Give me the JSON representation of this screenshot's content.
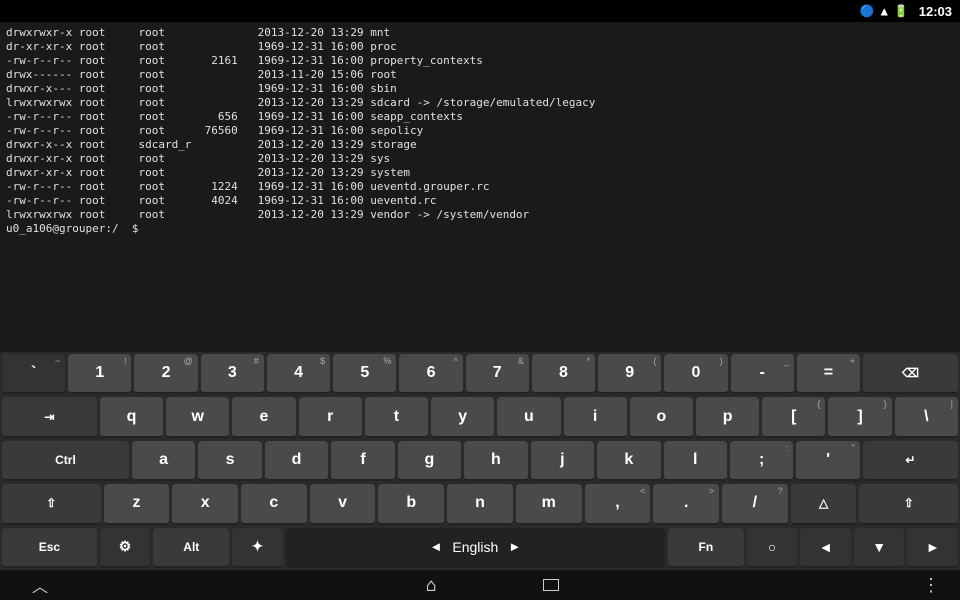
{
  "statusBar": {
    "time": "12:03",
    "icons": [
      "bluetooth",
      "wifi",
      "battery"
    ]
  },
  "terminal": {
    "lines": [
      "drwxrwxr-x root     root              2013-12-20 13:29 mnt",
      "dr-xr-xr-x root     root              1969-12-31 16:00 proc",
      "-rw-r--r-- root     root       2161   1969-12-31 16:00 property_contexts",
      "drwx------ root     root              2013-11-20 15:06 root",
      "drwxr-x--- root     root              1969-12-31 16:00 sbin",
      "lrwxrwxrwx root     root              2013-12-20 13:29 sdcard -> /storage/emulated/legacy",
      "-rw-r--r-- root     root        656   1969-12-31 16:00 seapp_contexts",
      "-rw-r--r-- root     root      76560   1969-12-31 16:00 sepolicy",
      "drwxr-x--x root     sdcard_r          2013-12-20 13:29 storage",
      "drwxr-xr-x root     root              2013-12-20 13:29 sys",
      "drwxr-xr-x root     root              2013-12-20 13:29 system",
      "-rw-r--r-- root     root       1224   1969-12-31 16:00 ueventd.grouper.rc",
      "-rw-r--r-- root     root       4024   1969-12-31 16:00 ueventd.rc",
      "lrwxrwxrwx root     root              2013-12-20 13:29 vendor -> /system/vendor",
      "u0_a106@grouper:/  $"
    ]
  },
  "keyboard": {
    "row1": [
      {
        "main": "1",
        "shift": "!",
        "w": 1
      },
      {
        "main": "2",
        "shift": "@",
        "w": 1
      },
      {
        "main": "3",
        "shift": "#",
        "w": 1
      },
      {
        "main": "4",
        "shift": "$",
        "w": 1
      },
      {
        "main": "5",
        "shift": "%",
        "w": 1
      },
      {
        "main": "6",
        "shift": "^",
        "w": 1
      },
      {
        "main": "7",
        "shift": "&",
        "w": 1
      },
      {
        "main": "8",
        "shift": "*",
        "w": 1
      },
      {
        "main": "9",
        "shift": "(",
        "w": 1
      },
      {
        "main": "0",
        "shift": ")",
        "w": 1
      },
      {
        "main": "-",
        "shift": "_",
        "w": 1
      },
      {
        "main": "=",
        "shift": "+",
        "w": 1
      },
      {
        "main": "⌫",
        "shift": "",
        "w": 1.5,
        "action": true
      }
    ],
    "row2": [
      {
        "main": "⇥",
        "shift": "",
        "w": 1.5,
        "action": true
      },
      {
        "main": "q",
        "shift": "",
        "w": 1
      },
      {
        "main": "w",
        "shift": "",
        "w": 1
      },
      {
        "main": "e",
        "shift": "",
        "w": 1
      },
      {
        "main": "r",
        "shift": "",
        "w": 1
      },
      {
        "main": "t",
        "shift": "",
        "w": 1
      },
      {
        "main": "y",
        "shift": "",
        "w": 1
      },
      {
        "main": "u",
        "shift": "",
        "w": 1
      },
      {
        "main": "i",
        "shift": "",
        "w": 1
      },
      {
        "main": "o",
        "shift": "",
        "w": 1
      },
      {
        "main": "p",
        "shift": "",
        "w": 1
      },
      {
        "main": "[",
        "shift": "{",
        "w": 1
      },
      {
        "main": "]",
        "shift": "}",
        "w": 1
      },
      {
        "main": "\\",
        "shift": "|",
        "w": 1
      }
    ],
    "row3": [
      {
        "main": "Ctrl",
        "shift": "",
        "w": 2,
        "action": true
      },
      {
        "main": "a",
        "shift": "",
        "w": 1
      },
      {
        "main": "s",
        "shift": "",
        "w": 1
      },
      {
        "main": "d",
        "shift": "",
        "w": 1
      },
      {
        "main": "f",
        "shift": "",
        "w": 1
      },
      {
        "main": "g",
        "shift": "",
        "w": 1
      },
      {
        "main": "h",
        "shift": "",
        "w": 1
      },
      {
        "main": "j",
        "shift": "",
        "w": 1
      },
      {
        "main": "k",
        "shift": "",
        "w": 1
      },
      {
        "main": "l",
        "shift": "",
        "w": 1
      },
      {
        "main": ";",
        "shift": ":",
        "w": 1
      },
      {
        "main": "'",
        "shift": "\"",
        "w": 1
      },
      {
        "main": "↵",
        "shift": "",
        "w": 1.5,
        "action": true
      }
    ],
    "row4": [
      {
        "main": "⇧",
        "shift": "",
        "w": 1.5,
        "action": true
      },
      {
        "main": "z",
        "shift": "",
        "w": 1
      },
      {
        "main": "x",
        "shift": "",
        "w": 1
      },
      {
        "main": "c",
        "shift": "",
        "w": 1
      },
      {
        "main": "v",
        "shift": "",
        "w": 1
      },
      {
        "main": "b",
        "shift": "",
        "w": 1
      },
      {
        "main": "n",
        "shift": "",
        "w": 1
      },
      {
        "main": "m",
        "shift": "",
        "w": 1
      },
      {
        "main": ",",
        "shift": "<",
        "w": 1
      },
      {
        "main": ".",
        "shift": ">",
        "w": 1
      },
      {
        "main": "/",
        "shift": "?",
        "w": 1
      },
      {
        "main": "△",
        "shift": "",
        "w": 1,
        "action": true
      },
      {
        "main": "⇧",
        "shift": "",
        "w": 1.5,
        "action": true
      }
    ],
    "row5": {
      "esc": "Esc",
      "settings": "⚙",
      "alt": "Alt",
      "logo": "✦",
      "langLeft": "◄",
      "lang": "English",
      "langRight": "►",
      "fn": "Fn",
      "circle": "○",
      "back": "◄",
      "down": "▼",
      "forward": "►"
    }
  },
  "navBar": {
    "back": "︿",
    "home": "⌂",
    "recent": "▭",
    "menu": "⋮"
  }
}
